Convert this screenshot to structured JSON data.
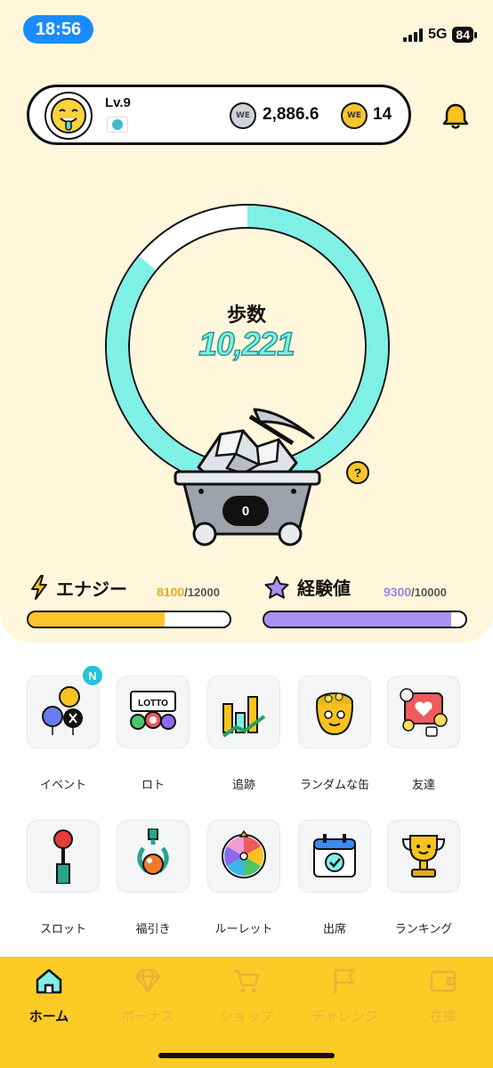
{
  "status_bar": {
    "time": "18:56",
    "network": "5G",
    "battery": "84"
  },
  "profile": {
    "level": "Lv.9",
    "silver_coins": "2,886.6",
    "gold_coins": "14"
  },
  "steps": {
    "label": "歩数",
    "value": "10,221",
    "ring_progress": 0.86
  },
  "cart": {
    "count": "0"
  },
  "energy": {
    "label": "エナジー",
    "current": "8100",
    "max": "/12000",
    "fraction": 0.675,
    "color": "#fac42b"
  },
  "experience": {
    "label": "経験値",
    "current": "9300",
    "max": "/10000",
    "fraction": 0.93,
    "color": "#a792f2"
  },
  "features": [
    {
      "label": "イベント",
      "icon": "event-icon",
      "badge": "N"
    },
    {
      "label": "ロト",
      "icon": "lotto-icon"
    },
    {
      "label": "追跡",
      "icon": "tracking-chart-icon"
    },
    {
      "label": "ランダムな缶",
      "icon": "random-can-icon"
    },
    {
      "label": "友達",
      "icon": "friends-icon"
    },
    {
      "label": "スロット",
      "icon": "slot-lever-icon"
    },
    {
      "label": "福引き",
      "icon": "claw-prize-icon"
    },
    {
      "label": "ルーレット",
      "icon": "roulette-icon"
    },
    {
      "label": "出席",
      "icon": "attendance-calendar-icon"
    },
    {
      "label": "ランキング",
      "icon": "ranking-trophy-icon"
    }
  ],
  "nav": [
    {
      "label": "ホーム",
      "icon": "home-icon",
      "active": true
    },
    {
      "label": "ボーナス",
      "icon": "diamond-icon"
    },
    {
      "label": "ショップ",
      "icon": "cart-icon"
    },
    {
      "label": "チャレンジ",
      "icon": "flag-icon"
    },
    {
      "label": "在庫",
      "icon": "wallet-icon"
    }
  ],
  "colors": {
    "accent_teal": "#7ff0e6",
    "nav_yellow": "#fccb26",
    "background": "#fff7dc"
  }
}
